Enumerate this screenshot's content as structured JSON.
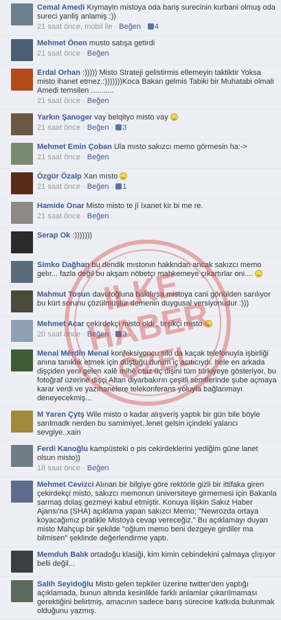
{
  "like_label": "Beğen",
  "watermark": {
    "line1": "ILKE",
    "line2": "HABER",
    "line3": "ÖZEL",
    "color": "#d83a34"
  },
  "comments": [
    {
      "name": "Cemal Amedi",
      "text": "Kıymayin mistoya oda bariş surecinin kurbani olmuş oda sureci yanliş anlamiş :))",
      "time": "21 saat önce, mobil ile",
      "likes": "4",
      "avatar_color": "#6b7f8f"
    },
    {
      "name": "Mehmet Önen",
      "text": "musto satışa getirdi",
      "time": "21 saat önce",
      "avatar_color": "#4c5e73"
    },
    {
      "name": "Erdal Orhan",
      "text": ":)))))  Misto Strateji gelistirmis ellemeyin taktiktir Yoksa misto ihanet etmez.:)))))))Koca Bakan gelmis Tabiki bir Muhatabi olmali Amedi temsilen ...........",
      "time": "21 saat önce",
      "avatar_color": "#b54a1e"
    },
    {
      "name": "Yarkın Şanoger",
      "text": "vay belqityo misto vay",
      "time": "21 saat önce",
      "likes": "3",
      "avatar_color": "#6a5840"
    },
    {
      "name": "Mehmet Emin Çoban",
      "text": "Ula mısto sakızcı memo görmesin ha:->",
      "time": "21 saat önce",
      "avatar_color": "#7a8a72"
    },
    {
      "name": "Özgür Özalp",
      "text": "Xan mısto",
      "time": "21 saat önce",
      "likes": "1",
      "avatar_color": "#5a2a1a"
    },
    {
      "name": "Hamide Onar",
      "text": "Misto misto te jî îxanet kir bi me re.",
      "time": "21 saat önce",
      "avatar_color": "#8d8a84"
    },
    {
      "name": "Serap Ok",
      "text": ":)))))))",
      "time": "",
      "avatar_color": "#2b2b2b"
    },
    {
      "name": "Simko Dağhan",
      "text": "bu dendik mıstonın hakkndan ancak sakızcı memo gelır... fazla değil bu akşam nöbetçı mahkemeye çıkartırlar oni....",
      "time": "",
      "avatar_color": "#5c6b7a"
    },
    {
      "name": "Mahmut Tosun",
      "text": "davutoğluna bakılırsa mistoya cani gönülden sarılıyor bu kürt sorunu çözülmüştür demenin duygusal versiyonudur :)))",
      "time": "",
      "avatar_color": "#4a4a3a"
    },
    {
      "name": "Mehmet Acar",
      "text": "çekirdekçi misto oldi , tırşikçi mısto",
      "time": "20 saat önce",
      "likes": "3",
      "avatar_color": "#8fa0b3"
    },
    {
      "name": "Menal Mêrdîn Menal",
      "text": "konfeksiyoncu silo da kaçak telefonuyla işbirliği anına tanıklık etmek için düştüğü durum iç acıtıcıydı. hele en arkada dişçiden yeni gelen xalê mihê otuz üç dişini tüm türkiyeye gösteriyor, bu fotoğraf üzerine dişçi Altan diyarbakırın çeşitli semtlerinde şube açmaya karar verdi ve yazıhanelere telekonferans yoluyla bağlanmayı deneyecekmiş...",
      "time": "",
      "avatar_color": "#3e5b35"
    },
    {
      "name": "M Yaren Çytş",
      "text": "Wile misto o kadar alışveriş yaptık bir gün bile böyle sarılmadk nerden bu samimiyet..lenet gelsin içindeki yalancı sevgiye..xain",
      "time": "",
      "avatar_color": "#a0893a"
    },
    {
      "name": "Ferdi Kanoğlu",
      "text": "kampüsteki o pis cekirdeklerini yediğim güne lanet olsun misto))",
      "time": "18 saat önce",
      "avatar_color": "#6f7d86"
    },
    {
      "name": "Mehmet Cevizci",
      "text": "Alınan bir bilgiye göre rektörle gizli bir ittifaka giren çekirdekçi misto, sakızcı memonun üniversiteye girmemesi için Bakanla sarmaş dolaş gezmeyi kabul etmiştir. Konuya ilişkin Sakız Haber Ajansı'na (SHA) açıklama yapan sakızcı Memo; \"Newrozda ortaya koyacağımız pratikle Mistoya cevap vereceğiz.\" Bu açıklamayı duyan misto Mahçup bir şekilde \"oğlum memo beni dezgeye girdiler ma bilmisen\" şeklinde değerlendirme yaptı.",
      "time": "",
      "avatar_color": "#5d6b8c"
    },
    {
      "name": "Memduh Balık",
      "text": "ortadoğu klasiği, kim kimin cebindekini çalmaya çlışıyor belli değil...",
      "time": "",
      "avatar_color": "#3a3f45"
    },
    {
      "name": "Salih Seyidoğlu",
      "text": "Misto gelen tepkiler üzerine twitter'den yaptığı açıklamada, bunun altında kesinlikle farklı anlamlar çıkarılmaması gerektiğini belirtmiş, amacının sadece barış sürecine katkıda bulunmak olduğunu yazmış.",
      "time": "",
      "avatar_color": "#5a6a5a"
    }
  ]
}
